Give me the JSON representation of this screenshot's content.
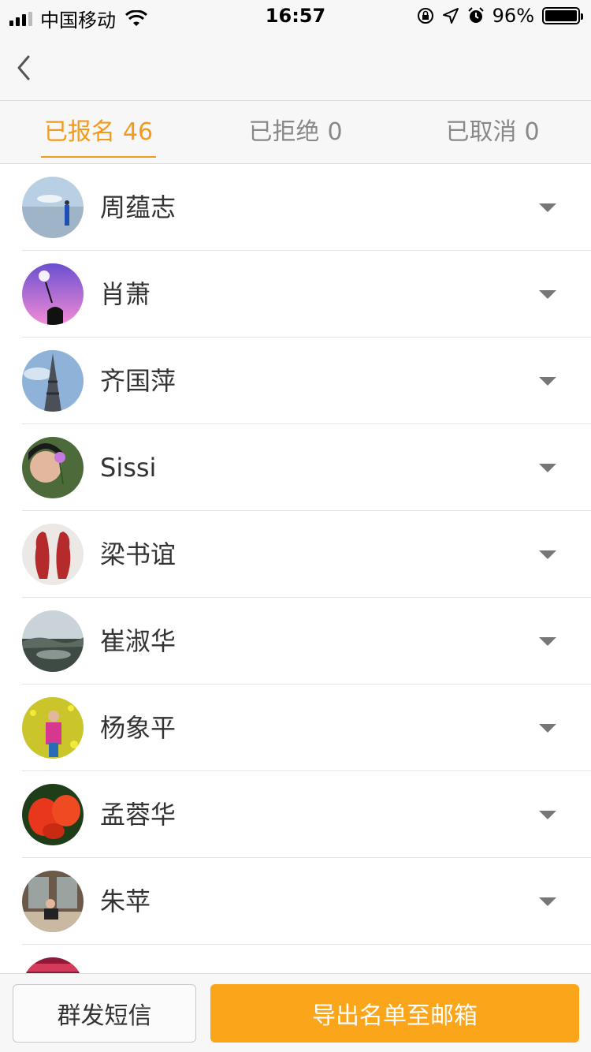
{
  "status_bar": {
    "carrier": "中国移动",
    "time": "16:57",
    "battery": "96%"
  },
  "nav": {
    "back_icon": "chevron-left-icon"
  },
  "tabs": [
    {
      "label": "已报名",
      "count": "46",
      "active": true
    },
    {
      "label": "已拒绝",
      "count": "0",
      "active": false
    },
    {
      "label": "已取消",
      "count": "0",
      "active": false
    }
  ],
  "attendees": [
    {
      "name": "周蕴志"
    },
    {
      "name": "肖萧"
    },
    {
      "name": "齐国萍"
    },
    {
      "name": "Sissi"
    },
    {
      "name": "梁书谊"
    },
    {
      "name": "崔淑华"
    },
    {
      "name": "杨象平"
    },
    {
      "name": "孟蓉华"
    },
    {
      "name": "朱苹"
    }
  ],
  "actions": {
    "sms_label": "群发短信",
    "export_label": "导出名单至邮箱"
  },
  "colors": {
    "accent": "#f39a1c",
    "export_button": "#fba51b"
  }
}
